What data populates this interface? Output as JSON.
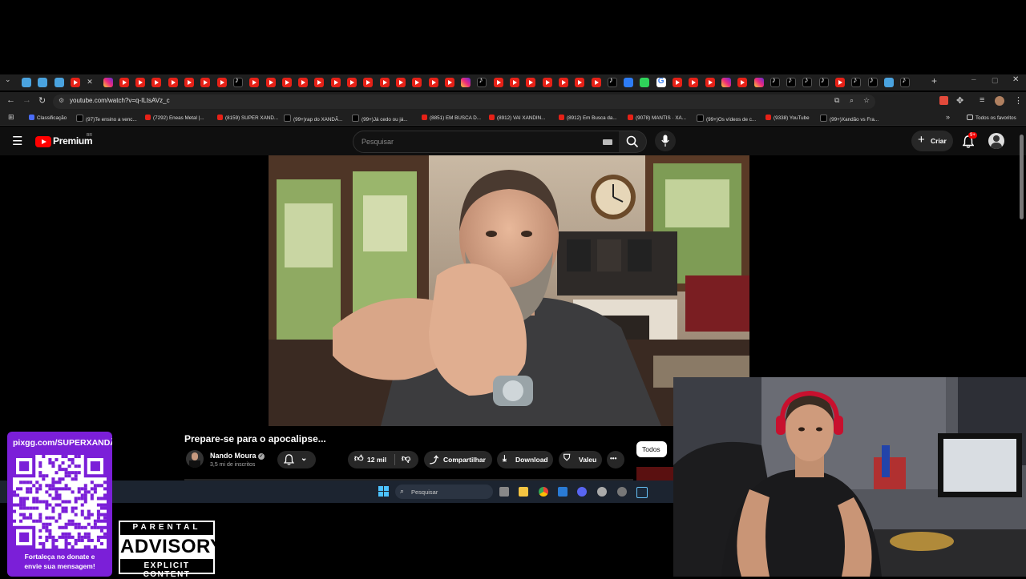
{
  "browser": {
    "url": "youtube.com/watch?v=q-ILtsAVz_c",
    "bookmarks": [
      {
        "label": "Classificação",
        "color": "#4a6cf7"
      },
      {
        "label": "(97)Te ensino a venc...",
        "color": "#000000"
      },
      {
        "label": "(7292) Eneas Metal |...",
        "color": "#e62117"
      },
      {
        "label": "(8159) SUPER XAND...",
        "color": "#e62117"
      },
      {
        "label": "(99+)rap do XANDÃ...",
        "color": "#000000"
      },
      {
        "label": "(99+)Já cedo ou já...",
        "color": "#000000"
      },
      {
        "label": "(8851) EM BUSCA D...",
        "color": "#e62117"
      },
      {
        "label": "(8912) VAI XANDIN...",
        "color": "#e62117"
      },
      {
        "label": "(8912) Em Busca da...",
        "color": "#e62117"
      },
      {
        "label": "(9078) MANTIS · XA...",
        "color": "#e62117"
      },
      {
        "label": "(99+)Os vídeos de c...",
        "color": "#000000"
      },
      {
        "label": "(9338) YouTube",
        "color": "#e62117"
      },
      {
        "label": "(99+)Xandão vs Fra...",
        "color": "#000000"
      }
    ],
    "all_bookmarks": "Todos os favoritos"
  },
  "youtube": {
    "logo_text": "Premium",
    "logo_region": "BR",
    "search_placeholder": "Pesquisar",
    "create_label": "Criar",
    "notif_count": "9+",
    "video_title": "Prepare-se para o apocalipse...",
    "channel_name": "Nando Moura",
    "subscribers": "3,5 mi de inscritos",
    "likes": "12 mil",
    "share_label": "Compartilhar",
    "download_label": "Download",
    "thanks_label": "Valeu",
    "more_label": "•••",
    "filter_chip": "Todos"
  },
  "taskbar": {
    "search_placeholder": "Pesquisar"
  },
  "overlay": {
    "pix_url": "pixgg.com/SUPERXANDÃ",
    "donate_line1": "Fortaleça no donate e",
    "donate_line2": "envie sua mensagem!",
    "advisory_top": "PARENTAL",
    "advisory_main": "ADVISORY",
    "advisory_bottom": "EXPLICIT CONTENT",
    "qr_color": "#7b1fd8"
  }
}
